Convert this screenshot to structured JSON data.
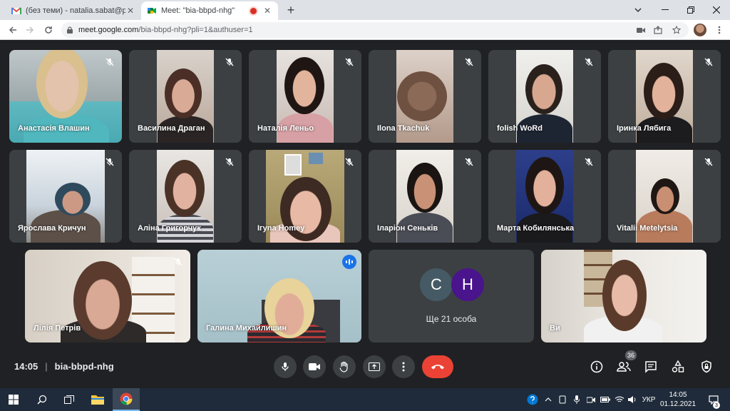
{
  "browser": {
    "tabs": [
      {
        "title": "(без теми) - natalia.sabat@pnu.e",
        "icon": "gmail-icon",
        "active": false
      },
      {
        "title": "Meet: \"bia-bbpd-nhg\"",
        "icon": "meet-icon",
        "active": true
      }
    ],
    "new_tab_label": "+",
    "url_host": "meet.google.com",
    "url_path": "/bia-bbpd-nhg?pli=1&authuser=1"
  },
  "meeting": {
    "time": "14:05",
    "code": "bia-bbpd-nhg",
    "participants_count": "36",
    "more_label": "Ще 21 особа",
    "more_avatars": [
      {
        "letter": "C",
        "color": "#455a64"
      },
      {
        "letter": "H",
        "color": "#4a148c"
      }
    ]
  },
  "tiles": [
    {
      "name": "Анастасія Влашин"
    },
    {
      "name": "Василина Драган"
    },
    {
      "name": "Наталія Леньо"
    },
    {
      "name": "Ilona Tkachuk"
    },
    {
      "name": "folish WoRd"
    },
    {
      "name": "Іринка Лябига"
    },
    {
      "name": "Ярослава Кричун"
    },
    {
      "name": "Аліна Григорчук"
    },
    {
      "name": "Ігуnа Homey"
    },
    {
      "name": "Іларіон Сеньків"
    },
    {
      "name": "Марта Кобилянська"
    },
    {
      "name": "Vitalii Metelytsia"
    },
    {
      "name": "Лілія Петрів"
    },
    {
      "name": "Галина Михайлишин"
    },
    {
      "name": "Ви"
    }
  ],
  "taskbar": {
    "language": "УКР",
    "time": "14:05",
    "date": "01.12.2021",
    "notifications": "3"
  },
  "colors": {
    "meet_bg": "#202124",
    "tile_bg": "#3c4043",
    "hangup": "#ea4335",
    "speaking": "#1a73e8"
  }
}
